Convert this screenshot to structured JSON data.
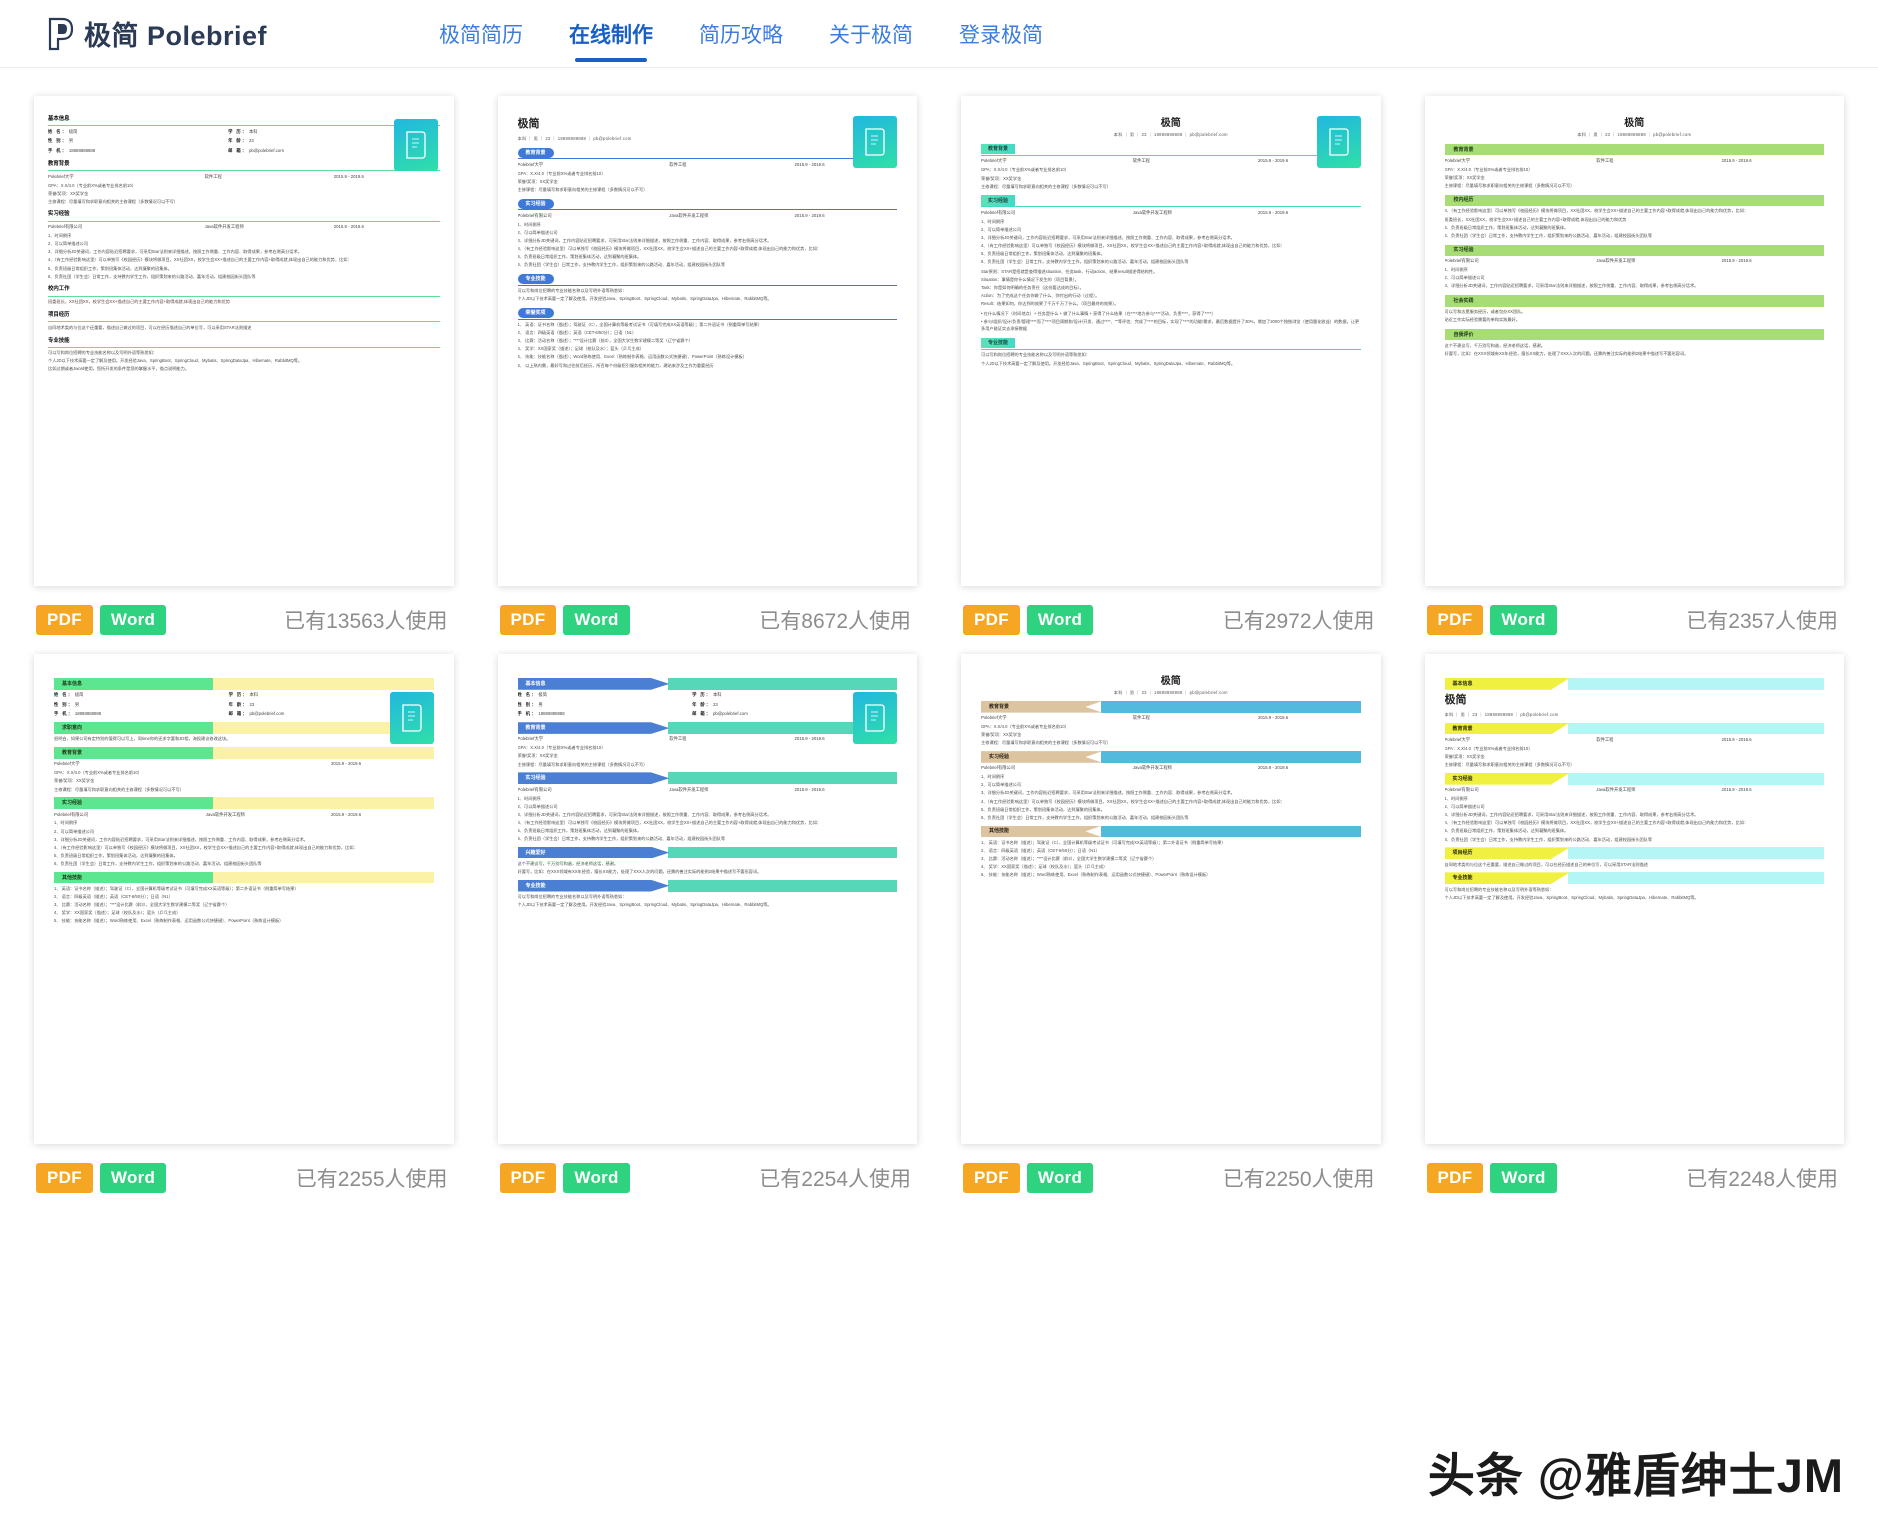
{
  "header": {
    "logo_text": "极简 Polebrief",
    "logo_icon": "polebrief-p-mark-icon",
    "nav": [
      {
        "label": "极简简历",
        "active": false
      },
      {
        "label": "在线制作",
        "active": true
      },
      {
        "label": "简历攻略",
        "active": false
      },
      {
        "label": "关于极简",
        "active": false
      },
      {
        "label": "登录极简",
        "active": false
      }
    ]
  },
  "colors": {
    "brand_blue": "#3b7ddd",
    "active_blue": "#1a5fc4",
    "pdf_orange": "#f5a623",
    "word_green": "#2fd27f",
    "used_gray": "#8d8d8d"
  },
  "resume_common": {
    "name": "极简",
    "name_label": "姓 名：",
    "name_value": "极简",
    "gender_label": "性 别：",
    "gender_value": "男",
    "phone_label": "手 机：",
    "phone_value": "18888888888",
    "degree_label": "学 历：",
    "degree_value": "本科",
    "age_label": "年 龄：",
    "age_value": "23",
    "email_label": "邮 箱：",
    "email_value": "pb@polebrief.com",
    "meta_line": "本科 ｜ 男 ｜ 23 ｜ 18888888888 ｜ pb@polebrief.com",
    "school": "Polebrief大学",
    "major": "软件工程",
    "date_range": "2015.9 - 2019.6",
    "company": "Polebrief有限公司",
    "job_title": "Java软件开发工程师",
    "edu_lines": [
      "GPA：X.X/4.0（专业前X%或者专业排名前10）",
      "荣誉/奖项：XX奖学金",
      "主修课程：尽量填写和求职意向相关的主修课程（多数情况可以不写）"
    ],
    "intern_lines": [
      "1、时间倒序",
      "2、可以简单描述公司",
      "3、详细分析JD关键词，工作内容贴近招聘要求，可采用Star法则来详细描述，按照工作侧重、工作内容、取得成果，参考右侧高分话术。",
      "4、（有工作经验影响这里）可以单独写《校园经历》模块将做项目，XX社团XX，校学生会XX+描述自己的主要工作内容+取得成就,体现出自己的能力和优势，比如：",
      "5、负责班级日常组织工作，策划班集体活动，达到凝聚的班集体。",
      "6、负责社团（学生会）日常工作，支持教内学生工作，组织策划来的公路活动、嘉年活动，组建校园街头团队等"
    ],
    "skills_lines": [
      "可以写和岗位招聘的专业技能名称以及写明外语等熟悉如：",
      "个人JD以下技术高要一定了解及使用。开发经验Java、SpringBoot、SpringCloud、Mybatis、SpringDataJpa、Hibernate、RabbitMQ等。",
      "比如过期或者Jword使用，您所开发的条件是您的掌握水平，描点说明能力。"
    ],
    "campus_work_text": "班委班长，XX社团XX，校学生会XX+描述自己的主要工作内容+取得成就,体现出自己的能力和优势",
    "project_lines": [
      "自同地术类的与位这个还重要，描述自己做过的项目，可以在经历描述自己的单位写，可以采用STAR法则描述"
    ],
    "intent_text": "很明白，如果公司有定特别的值得可以写上，同time你的还求字要和JD相，海投建议修改这块。",
    "social_lines": [
      "可以写和志愿服务经历，或者包办XX团队。",
      "贴近工作实际经验需要的单和实践最好。"
    ],
    "selfeval_lines": [
      "这个不建议写，千万别写和谐，经济老师这话，感谢。",
      "好要写，比如：在XXX领域有XX年经验，擅长XX能力，处理了XXX人次的问题。还需的善注实际的能例2结果中描述写不要形容词。"
    ],
    "honor_lines": [
      "1、 英语：证书名称（描述）；驾驶证（C），全国计算机等级考试证书（可填写完成XX英语等级）；第二外语证书（侧重简单写结果）",
      "2、 语言：四级英语（描述）；英语（CET-6/50分）；日语（N1）",
      "3、 比赛：活动名称（描述）；\"**\"设计比赛（前3），全国大学生数学建模二等奖（辽宁省赛个）",
      "4、 奖学：XX国家奖（描述）；足球（校队及水）；篮头（乒乓主成）",
      "5、 技能：技能名称（描述）；Word熟练使用、Excel（熟练制作表格、运用函数公式快捷键）、PowerPoint（熟练设计模板）",
      "6、 以上熟内需，最好写和过往前后经历，所百每个份级招引服务相关的能力，建贴来涉及工作为重要经历"
    ],
    "star_block": [
      "Star原则：STAR是招就是查得描述situation、任务task、行动action、结果result描述得结构性。",
      "Situation：事情是你什么情况下发生的（项目背景）。",
      "Task：你是如何明确的任务责任（这份要达成的目标）。",
      "Action：为了完成这个任务你做了什么、你付出的行动（过程）。",
      "Result：结果如何，你达到的效果了千万千万了什么。（项目最终的效果）。"
    ],
    "bullets_block": [
      "• 在什么情况下（时间地点）+ 任务是什么 + 做了什么事情 + 获得了什么结果（在****地方参与****活动、负责****，获得了****）",
      "• 参与/组织/设计/负责/管理****而了****项目周期和/设计/开发、通过****、\"\"等评估、完成了****的目标，实现了****的功能/需求，最后数据提升了30%，增加了2000个独独浏览（使用量化收益）的数据，让更多用户能证实去承接数据"
    ]
  },
  "cards": [
    {
      "id": "resume-template-1",
      "style": "underline-green",
      "used_text": "已有13563人使用",
      "pdf_label": "PDF",
      "word_label": "Word",
      "layout": "left-basic",
      "sections": [
        "基本信息",
        "教育背景",
        "实习经验",
        "校内工作",
        "项目经历",
        "专业技能"
      ]
    },
    {
      "id": "resume-template-2",
      "style": "pill-blue",
      "used_text": "已有8672人使用",
      "pdf_label": "PDF",
      "word_label": "Word",
      "layout": "left-name",
      "sections": [
        "教育背景",
        "实习经验",
        "专业技能",
        "荣誉奖项"
      ]
    },
    {
      "id": "resume-template-3",
      "style": "teal-tag",
      "used_text": "已有2972人使用",
      "pdf_label": "PDF",
      "word_label": "Word",
      "layout": "center-name",
      "sections": [
        "教育背景",
        "实习经验",
        "专业技能"
      ]
    },
    {
      "id": "resume-template-4",
      "style": "green-bar",
      "used_text": "已有2357人使用",
      "pdf_label": "PDF",
      "word_label": "Word",
      "layout": "center-name",
      "sections": [
        "教育背景",
        "校内经历",
        "实习经验",
        "社会实践",
        "自我评价"
      ]
    },
    {
      "id": "resume-template-5",
      "style": "green-yellow-split",
      "used_text": "已有2255人使用",
      "pdf_label": "PDF",
      "word_label": "Word",
      "layout": "left-basic",
      "sections": [
        "基本信息",
        "求职意向",
        "教育背景",
        "实习经验",
        "其他技能"
      ]
    },
    {
      "id": "resume-template-6",
      "style": "blue-arrow-teal",
      "used_text": "已有2254人使用",
      "pdf_label": "PDF",
      "word_label": "Word",
      "layout": "left-basic",
      "sections": [
        "基本信息",
        "教育背景",
        "实习经验",
        "兴趣爱好",
        "专业技能"
      ]
    },
    {
      "id": "resume-template-7",
      "style": "tan-blue",
      "used_text": "已有2250人使用",
      "pdf_label": "PDF",
      "word_label": "Word",
      "layout": "center-name",
      "sections": [
        "教育背景",
        "实习经验",
        "其他技能"
      ]
    },
    {
      "id": "resume-template-8",
      "style": "yellow-cyan",
      "used_text": "已有2248人使用",
      "pdf_label": "PDF",
      "word_label": "Word",
      "layout": "left-name-under",
      "sections": [
        "基本信息",
        "教育背景",
        "实习经验",
        "项目经历",
        "专业技能"
      ]
    }
  ],
  "watermark": {
    "text": "头条 @雅盾绅士JM"
  }
}
